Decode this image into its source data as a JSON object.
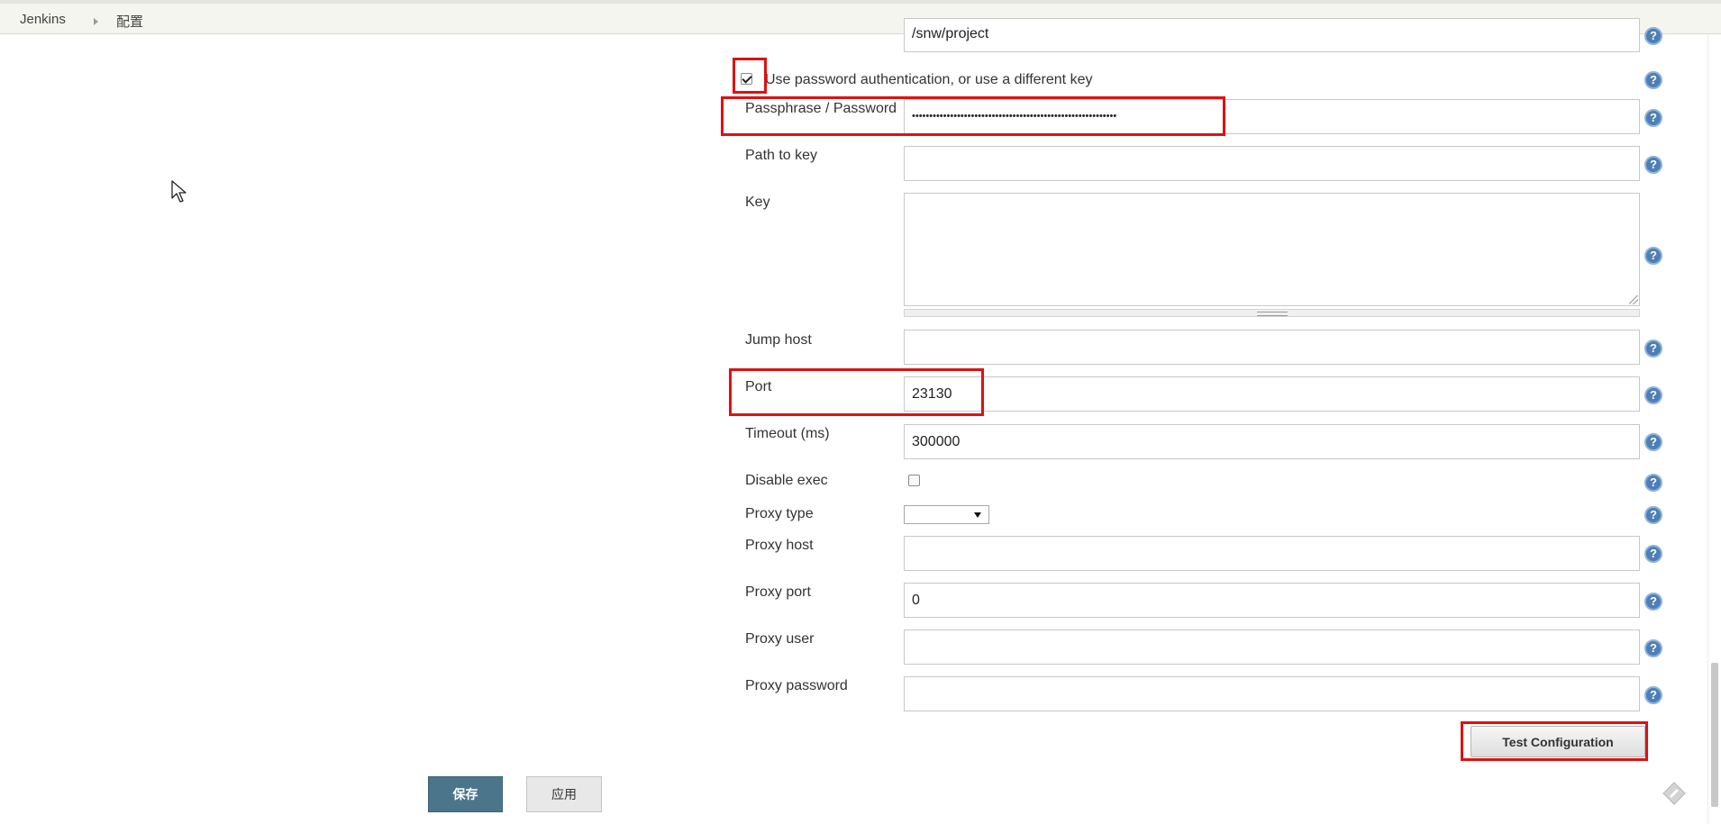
{
  "breadcrumb": {
    "items": [
      "Jenkins",
      "配置"
    ]
  },
  "form": {
    "path_partial_value": "/snw/project",
    "use_password_auth": {
      "label": "Use password authentication, or use a different key",
      "checked": true
    },
    "passphrase": {
      "label": "Passphrase / Password",
      "value": "•••••••••••••••••••••••••••••••••••••••••••••••••••••••••••"
    },
    "path_to_key": {
      "label": "Path to key",
      "value": ""
    },
    "key": {
      "label": "Key",
      "value": ""
    },
    "jump_host": {
      "label": "Jump host",
      "value": ""
    },
    "port": {
      "label": "Port",
      "value": "23130"
    },
    "timeout": {
      "label": "Timeout (ms)",
      "value": "300000"
    },
    "disable_exec": {
      "label": "Disable exec",
      "checked": false
    },
    "proxy_type": {
      "label": "Proxy type",
      "selected": ""
    },
    "proxy_host": {
      "label": "Proxy host",
      "value": ""
    },
    "proxy_port": {
      "label": "Proxy port",
      "value": "0"
    },
    "proxy_user": {
      "label": "Proxy user",
      "value": ""
    },
    "proxy_password": {
      "label": "Proxy password",
      "value": ""
    }
  },
  "help_glyph": "?",
  "buttons": {
    "test_configuration": "Test Configuration",
    "save": "保存",
    "apply": "应用"
  },
  "colors": {
    "annotation_red": "#e01010",
    "save_button": "#4b758b",
    "help_icon": "#4d7fb5"
  },
  "icons": {
    "help": "question-circle-icon",
    "breadcrumb_separator": "triangle-right-icon",
    "select_arrow": "caret-down-icon",
    "cursor": "mouse-pointer-icon",
    "corner": "jenkins-feedback-icon"
  }
}
